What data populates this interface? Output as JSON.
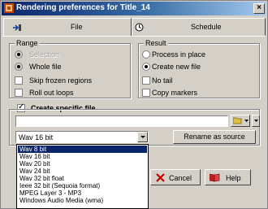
{
  "window": {
    "title": "Rendering preferences for Title_14",
    "close_glyph": "×"
  },
  "tabs": [
    {
      "label": "File",
      "icon": "file-output-icon"
    },
    {
      "label": "Schedule",
      "icon": "clock-icon"
    }
  ],
  "range": {
    "title": "Range",
    "options": [
      {
        "label": "Selection",
        "checked": false,
        "disabled": true
      },
      {
        "label": "Whole file",
        "checked": true,
        "disabled": true
      }
    ],
    "checkboxes": [
      {
        "label": "Skip frozen regions",
        "checked": false
      },
      {
        "label": "Roll out loops",
        "checked": false
      }
    ]
  },
  "result": {
    "title": "Result",
    "options": [
      {
        "label": "Process in place",
        "checked": false
      },
      {
        "label": "Create new file",
        "checked": true
      }
    ],
    "checkboxes": [
      {
        "label": "No tail",
        "checked": false
      },
      {
        "label": "Copy markers",
        "checked": false
      }
    ]
  },
  "create_specific_file": {
    "label": "Create specific file",
    "checked": true,
    "path_value": ""
  },
  "format_select": {
    "value": "Wav 16 bit"
  },
  "buttons": {
    "rename_source": "Rename as source",
    "cancel": "Cancel",
    "help": "Help"
  },
  "dropdown": {
    "items": [
      "Wav 8 bit",
      "Wav 16 bit",
      "Wav 20 bit",
      "Wav 24 bit",
      "Wav 32 bit float",
      "Ieee 32 bit (Sequoia format)",
      "MPEG Layer 3 - MP3",
      "Windows Audio Media (wma)"
    ],
    "selected_index": 0
  },
  "colors": {
    "title_start": "#0a246a",
    "title_end": "#a6caf0",
    "selection": "#0a246a",
    "face": "#d4d0c8"
  }
}
